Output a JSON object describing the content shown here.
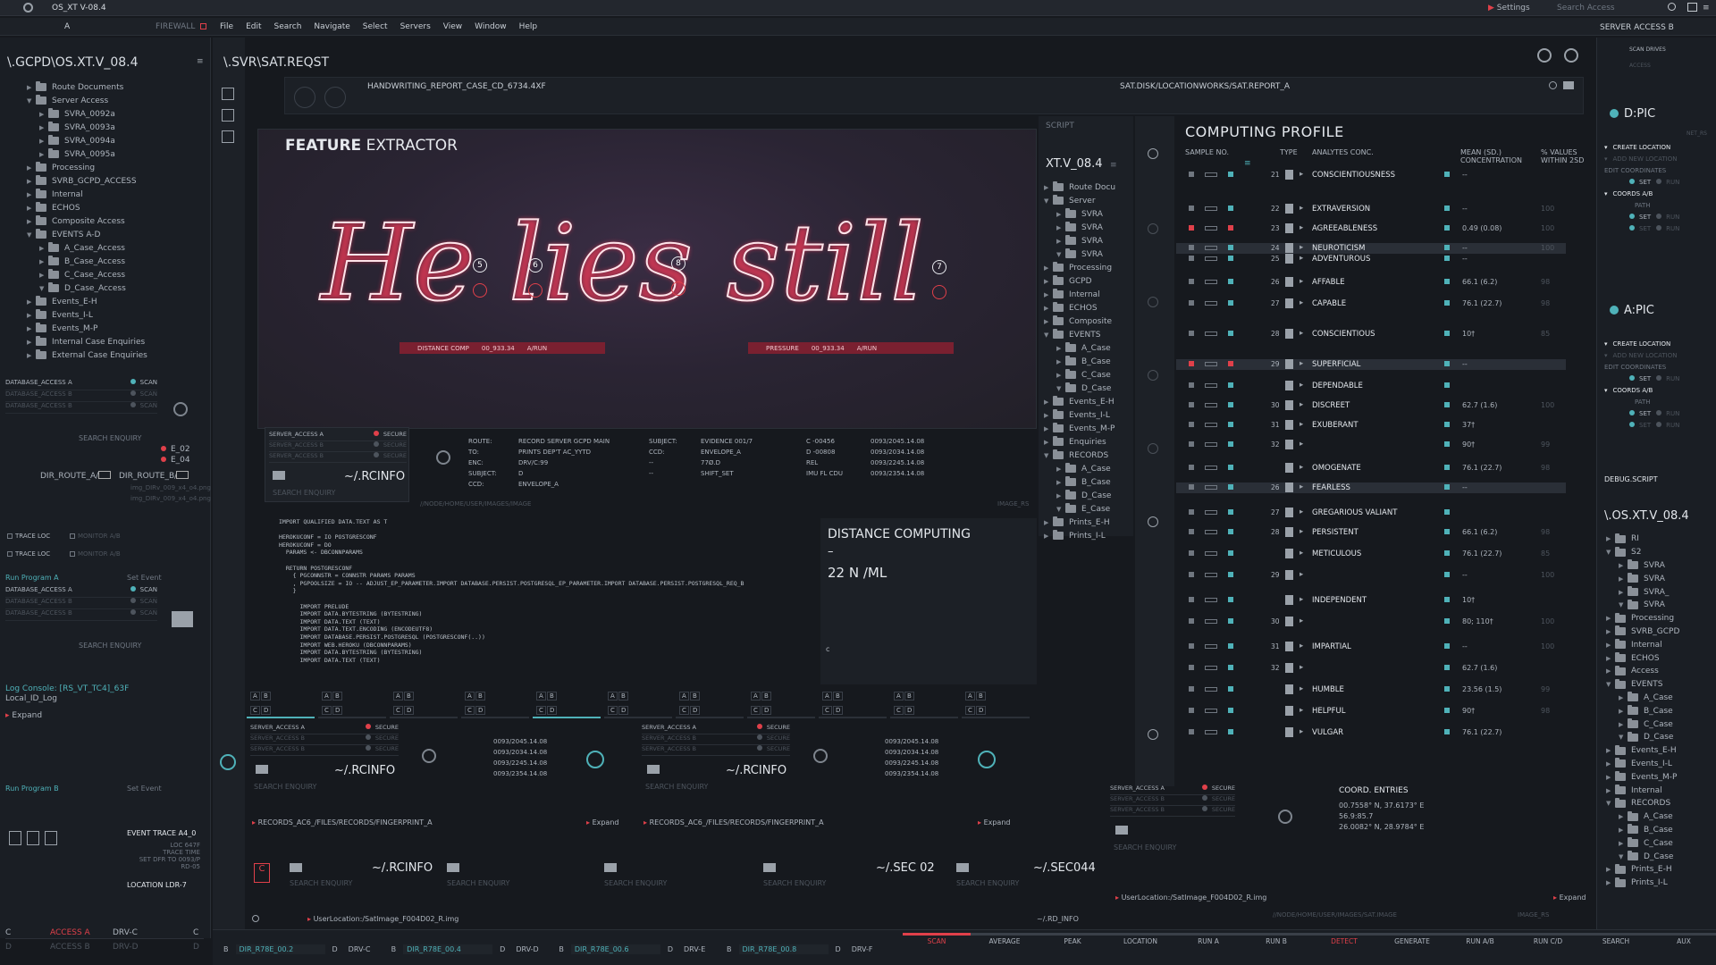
{
  "menubar": {
    "app_title": "OS_XT V-08.4",
    "firewall": "FIREWALL",
    "tab_a": "A",
    "menus": [
      "File",
      "Edit",
      "Search",
      "Navigate",
      "Select",
      "Servers",
      "View",
      "Window",
      "Help"
    ],
    "settings": "Settings",
    "search_access": "Search Access",
    "server_access": "SERVER ACCESS B"
  },
  "left": {
    "path": "\\.GCPD\\OS.XT.V_08.4",
    "tree": [
      {
        "l": "Route Documents",
        "d": 1,
        "o": 0
      },
      {
        "l": "Server Access",
        "d": 1,
        "o": 1
      },
      {
        "l": "SVRA_0092a",
        "d": 2,
        "o": 0
      },
      {
        "l": "SVRA_0093a",
        "d": 2,
        "o": 0
      },
      {
        "l": "SVRA_0094a",
        "d": 2,
        "o": 0
      },
      {
        "l": "SVRA_0095a",
        "d": 2,
        "o": 0
      },
      {
        "l": "Processing",
        "d": 1,
        "o": 0
      },
      {
        "l": "SVRB_GCPD_ACCESS",
        "d": 1,
        "o": 0
      },
      {
        "l": "Internal",
        "d": 1,
        "o": 0
      },
      {
        "l": "ECHOS",
        "d": 1,
        "o": 0
      },
      {
        "l": "Composite Access",
        "d": 1,
        "o": 0
      },
      {
        "l": "EVENTS A-D",
        "d": 1,
        "o": 1
      },
      {
        "l": "A_Case_Access",
        "d": 2,
        "o": 0
      },
      {
        "l": "B_Case_Access",
        "d": 2,
        "o": 0
      },
      {
        "l": "C_Case_Access",
        "d": 2,
        "o": 0
      },
      {
        "l": "D_Case_Access",
        "d": 2,
        "o": 1
      },
      {
        "l": "Events_E-H",
        "d": 1,
        "o": 0
      },
      {
        "l": "Events_I-L",
        "d": 1,
        "o": 0
      },
      {
        "l": "Events_M-P",
        "d": 1,
        "o": 0
      },
      {
        "l": "Internal Case Enquiries",
        "d": 1,
        "o": 0
      },
      {
        "l": "External Case Enquiries",
        "d": 1,
        "o": 0
      }
    ],
    "db": [
      "DATABASE_ACCESS A",
      "DATABASE_ACCESS B",
      "DATABASE_ACCESS B"
    ],
    "scan": "SCAN",
    "search_enquiry": "SEARCH ENQUIRY",
    "e_codes": [
      "E_02",
      "E_04"
    ],
    "dir_route_a": "DIR_ROUTE_A/",
    "dir_route_b": "DIR_ROUTE_B/",
    "img_files": [
      "img_DIRv_009_x4_o4.png",
      "img_DIRv_009_x4_o4.png"
    ],
    "trace_loc": "TRACE LOC",
    "monitor": "MONITOR A/B",
    "run_a": "Run Program A",
    "set_event": "Set Event",
    "log_console": "Log Console: [RS_VT_TC4]_63F",
    "local_id": "Local_ID_Log",
    "expand": "Expand",
    "run_b": "Run Program B",
    "event_trace": "EVENT TRACE A4_0",
    "event_lines": [
      "LOC 647F",
      "TRACE TIME",
      "SET DFR TO 0093/P",
      "RD-05"
    ],
    "location_ldr": "LOCATION LDR-7",
    "access_a": "ACCESS A",
    "drv_c": "DRV-C",
    "access_b": "ACCESS B",
    "drv_d": "DRV-D",
    "c": "C",
    "d": "D"
  },
  "main": {
    "path": "\\.SVR\\SAT.REQST",
    "report": "HANDWRITING_REPORT_CASE_CD_6734.4XF",
    "sat_path": "SAT.DISK/LOCATIONWORKS/SAT.REPORT_A",
    "small_path": "//NODE/HOME/USER/IMAGES/SAT.IMAGE",
    "image_rs": "IMAGE_RS",
    "feature_bold": "FEATURE",
    "feature_rest": " EXTRACTOR",
    "handwriting": "He lies still",
    "markers": [
      "5",
      "6",
      "8",
      "7"
    ],
    "distance_comp": "DISTANCE COMP",
    "dc_val": "00_933.34",
    "arun": "A/RUN",
    "pressure": "PRESSURE",
    "p_val": "00_933.34",
    "secure_rows": [
      "SERVER_ACCESS A",
      "SERVER_ACCESS B",
      "SERVER_ACCESS B"
    ],
    "secure": "SECURE",
    "rcinfo": "~/.RCINFO",
    "route": [
      [
        "ROUTE:",
        "RECORD SERVER GCPD MAIN"
      ],
      [
        "TO:",
        "PRINTS DEP'T AC_YYTD"
      ],
      [
        "ENC:",
        "DRV/C:99"
      ],
      [
        "SUBJECT:",
        "D"
      ],
      [
        "CCD:",
        "ENVELOPE_A"
      ]
    ],
    "subj": [
      [
        "SUBJECT:",
        "EVIDENCE 001/7"
      ],
      [
        "CCD:",
        "ENVELOPE_A"
      ],
      [
        "--",
        "77Ø.D"
      ],
      [
        "--",
        "SHIFT_SET"
      ]
    ],
    "coords": [
      [
        "C -00456",
        "0093/2045.14.08"
      ],
      [
        "D -00808",
        "0093/2034.14.08"
      ],
      [
        "REL",
        "0093/2245.14.08"
      ],
      [
        "IMU FL CDU",
        "0093/2354.14.08"
      ]
    ],
    "node_path": "//NODE/HOME/USER/IMAGES/IMAGE",
    "code": [
      "IMPORT QUALIFIED DATA.TEXT AS T",
      "",
      "HEROKUCONF = IO POSTGRESCONF",
      "HEROKUCONF = DO",
      "  PARAMS <- DBCONNPARAMS",
      "",
      "  RETURN POSTGRESCONF",
      "    { PGCONNSTR = CONNSTR PARAMS PARAMS",
      "    , PGPOOLSIZE = IO -- ADJUST_EP_PARAMETER.IMPORT DATABASE.PERSIST.POSTGRESQL_EP_PARAMETER.IMPORT DATABASE.PERSIST.POSTGRESQL_REQ_B",
      "    }",
      "",
      "      IMPORT PRELUDE",
      "      IMPORT DATA.BYTESTRING (BYTESTRING)",
      "      IMPORT DATA.TEXT (TEXT)",
      "      IMPORT DATA.TEXT.ENCODING (ENCODEUTF8)",
      "      IMPORT DATABASE.PERSIST.POSTGRESQL (POSTGRESCONF(..))",
      "      IMPORT WEB.HEROKU (DBCONNPARAMS)",
      "      IMPORT DATA.BYTESTRING (BYTESTRING)",
      "      IMPORT DATA.TEXT (TEXT)"
    ],
    "dist_title": "DISTANCE COMPUTING",
    "dist_dash": "–",
    "dist_val": "22 N /ML",
    "dist_c": "c",
    "timestamps": [
      "0093/2045.14.08",
      "0093/2034.14.08",
      "0093/2245.14.08",
      "0093/2354.14.08"
    ],
    "records_path": "RECORDS_AC6_/FILES/RECORDS/FINGERPRINT_A",
    "expand": "Expand",
    "sec02": "~/.SEC 02",
    "sec044": "~/.SEC044",
    "rd_info": "~/.RD_INFO",
    "user_loc": "UserLocation:/SatImage_F004D02_R.img"
  },
  "script": {
    "title": "SCRIPT",
    "os": "XT.V_08.4",
    "tree": [
      {
        "l": "Route Docu",
        "d": 1,
        "o": 0
      },
      {
        "l": "Server",
        "d": 1,
        "o": 1
      },
      {
        "l": "SVRA",
        "d": 2,
        "o": 0
      },
      {
        "l": "SVRA",
        "d": 2,
        "o": 0
      },
      {
        "l": "SVRA",
        "d": 2,
        "o": 0
      },
      {
        "l": "SVRA",
        "d": 2,
        "o": 1
      },
      {
        "l": "Processing",
        "d": 1,
        "o": 0
      },
      {
        "l": "GCPD",
        "d": 1,
        "o": 0
      },
      {
        "l": "Internal",
        "d": 1,
        "o": 0
      },
      {
        "l": "ECHOS",
        "d": 1,
        "o": 0
      },
      {
        "l": "Composite",
        "d": 1,
        "o": 0
      },
      {
        "l": "EVENTS",
        "d": 1,
        "o": 1
      },
      {
        "l": "A_Case",
        "d": 2,
        "o": 0
      },
      {
        "l": "B_Case",
        "d": 2,
        "o": 0
      },
      {
        "l": "C_Case",
        "d": 2,
        "o": 0
      },
      {
        "l": "D_Case",
        "d": 2,
        "o": 1
      },
      {
        "l": "Events_E-H",
        "d": 1,
        "o": 0
      },
      {
        "l": "Events_I-L",
        "d": 1,
        "o": 0
      },
      {
        "l": "Events_M-P",
        "d": 1,
        "o": 0
      },
      {
        "l": "Enquiries",
        "d": 1,
        "o": 0
      },
      {
        "l": "RECORDS",
        "d": 1,
        "o": 1
      },
      {
        "l": "A_Case",
        "d": 2,
        "o": 0
      },
      {
        "l": "B_Case",
        "d": 2,
        "o": 0
      },
      {
        "l": "D_Case",
        "d": 2,
        "o": 0
      },
      {
        "l": "E_Case",
        "d": 2,
        "o": 1
      },
      {
        "l": "Prints_E-H",
        "d": 1,
        "o": 0
      },
      {
        "l": "Prints_I-L",
        "d": 1,
        "o": 0
      }
    ]
  },
  "profile": {
    "title": "COMPUTING PROFILE",
    "cols": [
      "SAMPLE NO.",
      "TYPE",
      "ANALYTES CONC.",
      "MEAN (SD.) CONCENTRATION",
      "% VALUES WITHIN 2SD"
    ],
    "rows": [
      {
        "n": "21",
        "a": "CONSCIENTIOUSNESS",
        "m": "--",
        "p": ""
      },
      {
        "n": "22",
        "a": "EXTRAVERSION",
        "m": "--",
        "p": "100"
      },
      {
        "n": "23",
        "a": "AGREEABLENESS",
        "m": "0.49 (0.08)",
        "p": "100"
      },
      {
        "n": "24",
        "a": "NEUROTICISM",
        "m": "--",
        "p": "100"
      },
      {
        "n": "25",
        "a": "ADVENTUROUS",
        "m": "--",
        "p": ""
      },
      {
        "n": "26",
        "a": "AFFABLE",
        "m": "66.1 (6.2)",
        "p": "98"
      },
      {
        "n": "27",
        "a": "CAPABLE",
        "m": "76.1 (22.7)",
        "p": "98"
      },
      {
        "n": "28",
        "a": "CONSCIENTIOUS",
        "m": "10†",
        "p": "85"
      },
      {
        "n": "29",
        "a": "SUPERFICIAL",
        "m": "--",
        "p": ""
      },
      {
        "n": "",
        "a": "DEPENDABLE",
        "m": "",
        "p": ""
      },
      {
        "n": "30",
        "a": "DISCREET",
        "m": "62.7 (1.6)",
        "p": "100"
      },
      {
        "n": "31",
        "a": "EXUBERANT",
        "m": "37†",
        "p": ""
      },
      {
        "n": "32",
        "a": "",
        "m": "90†",
        "p": "99"
      },
      {
        "n": "",
        "a": "OMOGENATE",
        "m": "76.1 (22.7)",
        "p": "98"
      },
      {
        "n": "26",
        "a": "FEARLESS",
        "m": "--",
        "p": ""
      },
      {
        "n": "27",
        "a": "GREGARIOUS VALIANT",
        "m": "",
        "p": ""
      },
      {
        "n": "28",
        "a": "PERSISTENT",
        "m": "66.1 (6.2)",
        "p": "98"
      },
      {
        "n": "",
        "a": "METICULOUS",
        "m": "76.1 (22.7)",
        "p": "85"
      },
      {
        "n": "29",
        "a": "",
        "m": "--",
        "p": "100"
      },
      {
        "n": "",
        "a": "INDEPENDENT",
        "m": "10†",
        "p": ""
      },
      {
        "n": "30",
        "a": "",
        "m": "80; 110†",
        "p": "100"
      },
      {
        "n": "31",
        "a": "IMPARTIAL",
        "m": "--",
        "p": "100"
      },
      {
        "n": "32",
        "a": "",
        "m": "62.7 (1.6)",
        "p": ""
      },
      {
        "n": "",
        "a": "HUMBLE",
        "m": "23.56 (1.5)",
        "p": "99"
      },
      {
        "n": "",
        "a": "HELPFUL",
        "m": "90†",
        "p": "98"
      },
      {
        "n": "",
        "a": "VULGAR",
        "m": "76.1 (22.7)",
        "p": ""
      }
    ],
    "coord_title": "COORD. ENTRIES",
    "coord_lines": [
      "00.7558° N, 37.6173° E",
      "56.9:85.7",
      "26.0082° N, 28.9784° E"
    ],
    "user_loc": "UserLocation:/SatImage_F004D02_R.img",
    "node_path": "//NODE/HOME/USER/IMAGES/SAT.IMAGE",
    "image_rs": "IMAGE_RS"
  },
  "right": {
    "scan_drives": "SCAN DRIVES",
    "access": "ACCESS",
    "dpic": "D:PIC",
    "apic": "A:PIC",
    "net": "NET_RS",
    "create": "CREATE LOCATION",
    "add_new": "ADD NEW LOCATION",
    "edit_coords": "EDIT COORDINATES",
    "set": "SET",
    "run": "RUN",
    "coords_ab": "COORDS A/B",
    "path": "PATH",
    "debug": "DEBUG.SCRIPT",
    "os": "\\.OS.XT.V_08.4",
    "tree": [
      {
        "l": "RI",
        "d": 1,
        "o": 0
      },
      {
        "l": "S2",
        "d": 1,
        "o": 1
      },
      {
        "l": "SVRA",
        "d": 2,
        "o": 0
      },
      {
        "l": "SVRA",
        "d": 2,
        "o": 0
      },
      {
        "l": "SVRA_",
        "d": 2,
        "o": 0
      },
      {
        "l": "SVRA",
        "d": 2,
        "o": 1
      },
      {
        "l": "Processing",
        "d": 1,
        "o": 0
      },
      {
        "l": "SVRB_GCPD",
        "d": 1,
        "o": 0
      },
      {
        "l": "Internal",
        "d": 1,
        "o": 0
      },
      {
        "l": "ECHOS",
        "d": 1,
        "o": 0
      },
      {
        "l": "Access",
        "d": 1,
        "o": 0
      },
      {
        "l": "EVENTS",
        "d": 1,
        "o": 1
      },
      {
        "l": "A_Case",
        "d": 2,
        "o": 0
      },
      {
        "l": "B_Case",
        "d": 2,
        "o": 0
      },
      {
        "l": "C_Case",
        "d": 2,
        "o": 0
      },
      {
        "l": "D_Case",
        "d": 2,
        "o": 1
      },
      {
        "l": "Events_E-H",
        "d": 1,
        "o": 0
      },
      {
        "l": "Events_I-L",
        "d": 1,
        "o": 0
      },
      {
        "l": "Events_M-P",
        "d": 1,
        "o": 0
      },
      {
        "l": "Internal",
        "d": 1,
        "o": 0
      },
      {
        "l": "RECORDS",
        "d": 1,
        "o": 1
      },
      {
        "l": "A_Case",
        "d": 2,
        "o": 0
      },
      {
        "l": "B_Case",
        "d": 2,
        "o": 0
      },
      {
        "l": "C_Case",
        "d": 2,
        "o": 0
      },
      {
        "l": "D_Case",
        "d": 2,
        "o": 1
      },
      {
        "l": "Prints_E-H",
        "d": 1,
        "o": 0
      },
      {
        "l": "Prints_I-L",
        "d": 1,
        "o": 0
      }
    ]
  },
  "bottom": {
    "drives": [
      [
        "B",
        "DIR_R78E_00.2",
        "D",
        "DRV-C"
      ],
      [
        "B",
        "DIR_R78E_00.4",
        "D",
        "DRV-D"
      ],
      [
        "B",
        "DIR_R78E_00.6",
        "D",
        "DRV-E"
      ],
      [
        "B",
        "DIR_R78E_00.8",
        "D",
        "DRV-F"
      ]
    ],
    "actions": [
      "SCAN",
      "AVERAGE",
      "PEAK",
      "LOCATION",
      "RUN A",
      "RUN B",
      "DETECT",
      "GENERATE",
      "RUN A/B",
      "RUN C/D",
      "SEARCH",
      "AUX"
    ]
  },
  "colors": {
    "accent_red": "#e0404a",
    "teal": "#4fb2b9"
  }
}
